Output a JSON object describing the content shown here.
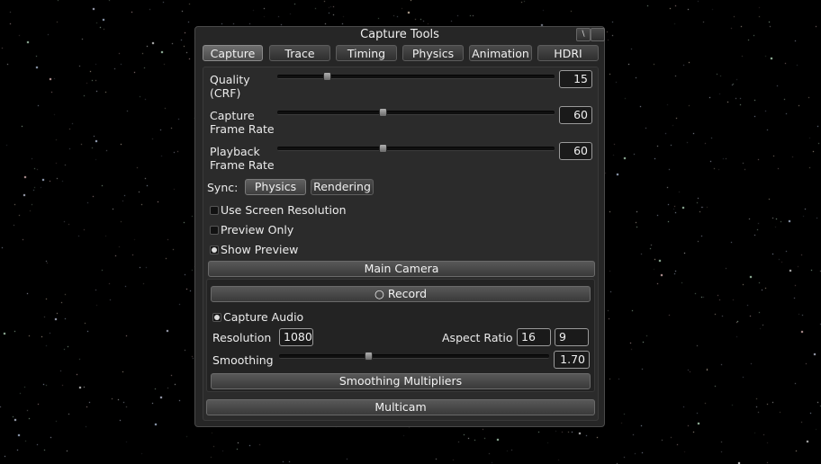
{
  "window": {
    "title": "Capture Tools",
    "help_button": "\\"
  },
  "tabs": [
    {
      "label": "Capture",
      "active": true
    },
    {
      "label": "Trace",
      "active": false
    },
    {
      "label": "Timing",
      "active": false
    },
    {
      "label": "Physics",
      "active": false
    },
    {
      "label": "Animation",
      "active": false
    },
    {
      "label": "HDRI",
      "active": false
    }
  ],
  "capture": {
    "quality": {
      "label_line1": "Quality",
      "label_line2": "(CRF)",
      "value": "15",
      "slider_fraction": 0.18
    },
    "capture_frame_rate": {
      "label_line1": "Capture",
      "label_line2": "Frame Rate",
      "value": "60",
      "slider_fraction": 0.38
    },
    "playback_frame_rate": {
      "label_line1": "Playback",
      "label_line2": "Frame Rate",
      "value": "60",
      "slider_fraction": 0.38
    },
    "sync": {
      "label": "Sync:",
      "options": [
        "Physics",
        "Rendering"
      ],
      "selected": "Physics"
    },
    "use_screen_resolution": {
      "label": "Use Screen Resolution",
      "checked": false
    },
    "preview_only": {
      "label": "Preview Only",
      "checked": false
    },
    "show_preview": {
      "label": "Show Preview",
      "checked": true
    },
    "main_camera_label": "Main Camera",
    "record_label": "○ Record",
    "capture_audio": {
      "label": "Capture Audio",
      "checked": true
    },
    "resolution": {
      "label": "Resolution",
      "value": "1080"
    },
    "aspect_ratio": {
      "label": "Aspect Ratio",
      "width": "16",
      "height": "9"
    },
    "smoothing": {
      "label": "Smoothing",
      "value": "1.70",
      "slider_fraction": 0.33
    },
    "smoothing_multipliers_label": "Smoothing Multipliers",
    "multicam_label": "Multicam"
  },
  "colors": {
    "background": "#000000",
    "window": "#262626",
    "accent": "#9a9a9a"
  }
}
